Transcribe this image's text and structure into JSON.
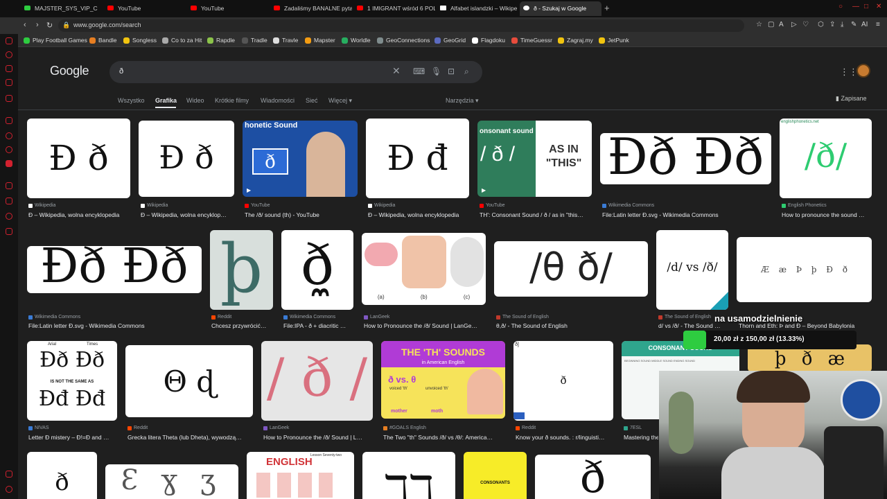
{
  "browser_tabs": [
    {
      "title": "MAJSTER_SYS_VIP_C",
      "color": "#2ecc40"
    },
    {
      "title": "YouTube",
      "color": "#ff0000"
    },
    {
      "title": "YouTube",
      "color": "#ff0000"
    },
    {
      "title": "Zadaliśmy BANALNE pyta",
      "color": "#ff0000"
    },
    {
      "title": "1 IMIGRANT wśród 6 POLA",
      "color": "#ff0000"
    },
    {
      "title": "Alfabet islandzki – Wikipe",
      "color": "#ffffff"
    },
    {
      "title": "ð - Szukaj w Google",
      "color": "#ffffff"
    }
  ],
  "address": {
    "url": "www.google.com/search"
  },
  "bookmarks": [
    "Play Football Games",
    "Bandle",
    "Songless",
    "Co to za Hit",
    "Rapdle",
    "Tradle",
    "Travle",
    "Mapster",
    "Worldle",
    "GeoConnections",
    "GeoGrid",
    "Flagdoku",
    "TimeGuessr",
    "Zagraj.my",
    "JetPunk"
  ],
  "google": {
    "logo": "Google",
    "query": "ð",
    "nav_tabs": [
      "Wszystko",
      "Grafika",
      "Wideo",
      "Krótkie filmy",
      "Wiadomości",
      "Sieć",
      "Więcej"
    ],
    "tools": "Narzędzia",
    "saved": "Zapisane"
  },
  "results": {
    "row1": [
      {
        "glyph": "Đ ð",
        "source": "Wikipedia",
        "title": "Ð – Wikipedia, wolna encyklopedia"
      },
      {
        "glyph": "Đ ð",
        "source": "Wikipedia",
        "title": "Đ – Wikipedia, wolna encyklop…"
      },
      {
        "glyph": "ð",
        "overlay": "honetic Sound",
        "source": "YouTube",
        "title": "The /ð/ sound (th) - YouTube"
      },
      {
        "glyph": "Đ đ",
        "source": "Wikipedia",
        "title": "Đ – Wikipedia, wolna encyklopedia"
      },
      {
        "glyph": "/ ð /",
        "overlay": "onsonant sound",
        "side": "AS IN \"THIS\"",
        "source": "YouTube",
        "title": "TH': Consonant Sound / ð / as in \"this…"
      },
      {
        "glyph": "Ðð Ðð",
        "source": "Wikimedia Commons",
        "title": "File:Latin letter Ð.svg - Wikimedia Commons"
      },
      {
        "glyph": "/ð/",
        "overlay": "englishphonetics.net",
        "source": "English Phonetics",
        "title": "How to pronounce the sound …"
      }
    ],
    "row2": [
      {
        "glyph": "Ðð Ðð",
        "source": "Wikimedia Commons",
        "title": "File:Latin letter Ð.svg - Wikimedia Commons"
      },
      {
        "glyph": "þ",
        "source": "Reddit",
        "title": "Chcesz przywrócić…"
      },
      {
        "glyph": "ð̼",
        "source": "Wikimedia Commons",
        "title": "File:IPA - ð + diacritic …"
      },
      {
        "glyph": "(a) (b) (c)",
        "source": "LanGeek",
        "title": "How to Pronounce the /ð/ Sound | LanGe…"
      },
      {
        "glyph": "/θ ð/",
        "source": "The Sound of English",
        "title": "θ,ð/ - The Sound of English"
      },
      {
        "glyph": "/d/ vs /ð/",
        "source": "The Sound of English",
        "title": "d/ vs /ð/ - The Sound …"
      },
      {
        "glyph": "Æ æ  Þ þ  Ð ð",
        "source": "",
        "title": "Thorn and Eth: Þ and Ð – Beyond Babylonia"
      }
    ],
    "row3": [
      {
        "glyph": "Ðð Ðð",
        "sub": "IS NOT THE SAME AS",
        "glyph2": "Đđ Đđ",
        "labels": [
          "Arial",
          "Times"
        ],
        "source": "NIVAS",
        "title": "Letter Ð mistery – Ð!=Ð and …"
      },
      {
        "glyph": "Θ ɖ",
        "source": "Reddit",
        "title": "Grecka litera Theta (lub Dheta), wywodzą…"
      },
      {
        "glyph": "/ ð /",
        "source": "LanGeek",
        "title": "How to Pronounce the /ð/ Sound | L…"
      },
      {
        "glyph": "THE 'TH' SOUNDS",
        "sub": "in American English",
        "words": [
          "ð vs. θ",
          "voiced 'th'",
          "unvoiced 'th'",
          "mother",
          "moth"
        ],
        "source": "#GOALS English",
        "title": "The Two \"th\" Sounds /ð/ vs /θ/: America…"
      },
      {
        "glyph": "ð",
        "corner": "ð]",
        "source": "Reddit",
        "title": "Know your ð sounds. : r/linguisti…"
      },
      {
        "glyph": "CONSONANT SOUND",
        "sub": "BEGINNING SOUND   MIDDLE SOUND   ENDING SOUND",
        "source": "7ESL",
        "title": "Mastering the"
      },
      {
        "glyph": "þ ð æ",
        "source": "",
        "title": ""
      }
    ],
    "row4": [
      {
        "glyph": "ð"
      },
      {
        "glyph": "Ɛ ɣ ʒ"
      },
      {
        "glyph": "ENGLISH",
        "sub": "Lesson Seventy-two"
      },
      {
        "glyph": "ℸℸ"
      },
      {
        "glyph": "CONSONANTS"
      },
      {
        "glyph": "ð"
      }
    ]
  },
  "stream": {
    "donation_title": "na usamodzielnienie",
    "donation_amount": "20,00 zł z 150,00 zł (13.33%)",
    "donation_progress": 0.1333
  }
}
